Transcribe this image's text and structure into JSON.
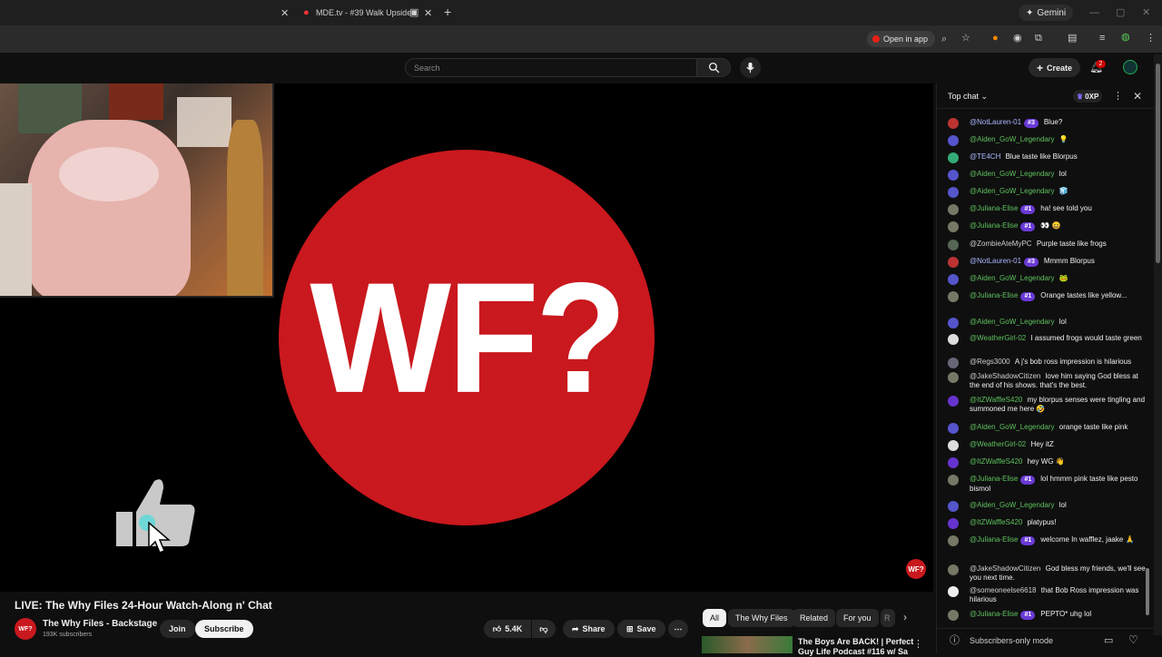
{
  "browser": {
    "tab_title": "MDE.tv - #39 Walk Upside",
    "open_in_app": "Open in app",
    "gemini": "Gemini"
  },
  "youtube": {
    "search_placeholder": "Search",
    "create_label": "Create",
    "notifications_count": "2"
  },
  "player": {
    "logo_text": "WF?",
    "watermark": "WF?"
  },
  "video": {
    "title": "LIVE: The Why Files 24-Hour Watch-Along n' Chat",
    "channel_name": "The Why Files - Backstage",
    "channel_avatar": "WF?",
    "subscribers": "193K subscribers",
    "join_label": "Join",
    "subscribe_label": "Subscribe",
    "likes": "5.4K",
    "share_label": "Share",
    "save_label": "Save"
  },
  "chips": [
    "All",
    "The Why Files",
    "Related",
    "For you",
    "R"
  ],
  "up_next": {
    "title_line1": "The Boys Are BACK! | Perfect",
    "title_line2": "Guy Life Podcast #116 w/ Sa"
  },
  "chat": {
    "title": "Top chat",
    "xp_label": "0XP",
    "footer": "Subscribers-only mode",
    "messages": [
      {
        "author": "@NotLauren-01",
        "badge": "#3",
        "text": "Blue?",
        "color": "blue",
        "avatar": "#b33"
      },
      {
        "author": "@Aiden_GoW_Legendary",
        "badge": "",
        "text": "💡",
        "color": "green",
        "avatar": "#55c"
      },
      {
        "author": "@TE4CH",
        "badge": "",
        "text": "Blue taste like Blorpus",
        "color": "blue",
        "avatar": "#3a7"
      },
      {
        "author": "@Aiden_GoW_Legendary",
        "badge": "",
        "text": "lol",
        "color": "green",
        "avatar": "#55c"
      },
      {
        "author": "@Aiden_GoW_Legendary",
        "badge": "",
        "text": "🧊",
        "color": "green",
        "avatar": "#55c"
      },
      {
        "author": "@Juliana-Elise",
        "badge": "#1",
        "text": "ha! see told you",
        "color": "green",
        "avatar": "#776"
      },
      {
        "author": "@Juliana-Elise",
        "badge": "#1",
        "text": "👀 😄",
        "color": "green",
        "avatar": "#776"
      },
      {
        "author": "@ZombieAteMyPC",
        "badge": "",
        "text": "Purple taste like frogs",
        "color": "gray",
        "avatar": "#565"
      },
      {
        "author": "@NotLauren-01",
        "badge": "#3",
        "text": "Mmmm Blorpus",
        "color": "blue",
        "avatar": "#b33"
      },
      {
        "author": "@Aiden_GoW_Legendary",
        "badge": "",
        "text": "🐸",
        "color": "green",
        "avatar": "#55c"
      },
      {
        "author": "@Juliana-Elise",
        "badge": "#1",
        "text": "Orange tastes like yellow...",
        "color": "green",
        "avatar": "#776"
      },
      {
        "author": "@Aiden_GoW_Legendary",
        "badge": "",
        "text": "lol",
        "color": "green",
        "avatar": "#55c"
      },
      {
        "author": "@WeatherGirl-02",
        "badge": "",
        "text": "I assumed frogs would taste green",
        "color": "green",
        "avatar": "#ddd"
      },
      {
        "author": "@Regs3000",
        "badge": "",
        "text": "A j's bob ross impression is hilarious",
        "color": "gray",
        "avatar": "#667"
      },
      {
        "author": "@JakeShadowCitizen",
        "badge": "",
        "text": "love him saying God bless at the end of his shows. that's the best.",
        "color": "gray",
        "avatar": "#776"
      },
      {
        "author": "@ItZWaffleS420",
        "badge": "",
        "text": "my blorpus senses were tingling and summoned me here 🤣",
        "color": "green",
        "avatar": "#63c"
      },
      {
        "author": "@Aiden_GoW_Legendary",
        "badge": "",
        "text": "orange taste like pink",
        "color": "green",
        "avatar": "#55c"
      },
      {
        "author": "@WeatherGirl-02",
        "badge": "",
        "text": "Hey itZ",
        "color": "green",
        "avatar": "#ddd"
      },
      {
        "author": "@ItZWaffleS420",
        "badge": "",
        "text": "hey WG 👋",
        "color": "green",
        "avatar": "#63c"
      },
      {
        "author": "@Juliana-Elise",
        "badge": "#1",
        "text": "lol hmmm pink taste like pesto bismol",
        "color": "green",
        "avatar": "#776"
      },
      {
        "author": "@Aiden_GoW_Legendary",
        "badge": "",
        "text": "lol",
        "color": "green",
        "avatar": "#55c"
      },
      {
        "author": "@ItZWaffleS420",
        "badge": "",
        "text": "platypus!",
        "color": "green",
        "avatar": "#63c"
      },
      {
        "author": "@Juliana-Elise",
        "badge": "#1",
        "text": "welcome In wafflez, jaake 🙏",
        "color": "green",
        "avatar": "#776"
      },
      {
        "author": "@JakeShadowCitizen",
        "badge": "",
        "text": "God bless my friends, we'll see you next time.",
        "color": "gray",
        "avatar": "#776"
      },
      {
        "author": "@someoneelse6618",
        "badge": "",
        "text": "that Bob Ross impression was hilarious",
        "color": "gray",
        "avatar": "#eee"
      },
      {
        "author": "@Juliana-Elise",
        "badge": "#1",
        "text": "PEPTO* uhg lol",
        "color": "green",
        "avatar": "#776"
      }
    ]
  }
}
